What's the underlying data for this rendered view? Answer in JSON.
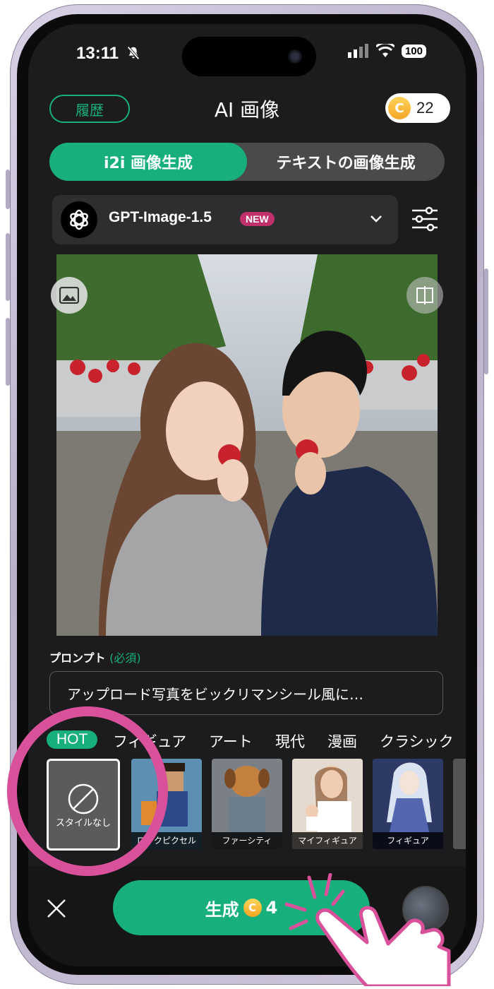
{
  "status_bar": {
    "time": "13:11",
    "battery": "100"
  },
  "header": {
    "history_label": "履歴",
    "title": "AI 画像",
    "coin_count": "22",
    "coin_symbol": "C"
  },
  "mode_tabs": [
    {
      "label": "i2i 画像生成",
      "active": true
    },
    {
      "label": "テキストの画像生成",
      "active": false
    }
  ],
  "model": {
    "name": "GPT-Image-1.5",
    "badge": "NEW"
  },
  "prompt": {
    "label": "プロンプト",
    "required_label": "(必須)",
    "value": "アップロード写真をビックリマンシール風に…"
  },
  "categories": [
    "HOT",
    "フィギュア",
    "アート",
    "現代",
    "漫画",
    "クラシック"
  ],
  "styles": [
    {
      "label": "スタイルなし",
      "selected": true
    },
    {
      "label": "ロックピクセル"
    },
    {
      "label": "ファーシティ"
    },
    {
      "label": "マイフィギュア"
    },
    {
      "label": "フィギュア"
    }
  ],
  "bottom": {
    "generate_label": "生成",
    "generate_cost": "4",
    "coin_symbol": "C"
  },
  "colors": {
    "accent": "#17b07c",
    "highlight": "#d9519a",
    "background": "#1c1c1e"
  }
}
